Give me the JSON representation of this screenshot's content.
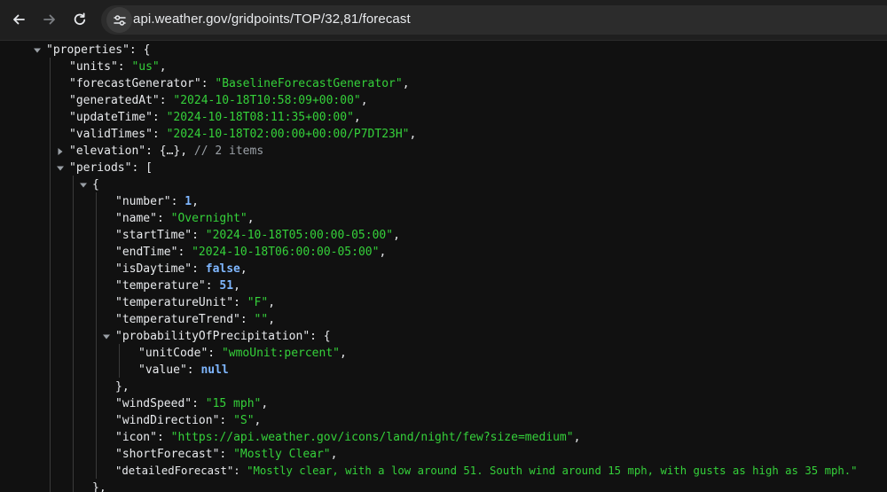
{
  "browser": {
    "url": "api.weather.gov/gridpoints/TOP/32,81/forecast"
  },
  "json": {
    "properties_key": "\"properties\"",
    "units_key": "\"units\"",
    "units_val": "\"us\"",
    "forecastGenerator_key": "\"forecastGenerator\"",
    "forecastGenerator_val": "\"BaselineForecastGenerator\"",
    "generatedAt_key": "\"generatedAt\"",
    "generatedAt_val": "\"2024-10-18T10:58:09+00:00\"",
    "updateTime_key": "\"updateTime\"",
    "updateTime_val": "\"2024-10-18T08:11:35+00:00\"",
    "validTimes_key": "\"validTimes\"",
    "validTimes_val": "\"2024-10-18T02:00:00+00:00/P7DT23H\"",
    "elevation_key": "\"elevation\"",
    "elevation_collapsed": "{…}",
    "elevation_comment": "// 2 items",
    "periods_key": "\"periods\"",
    "number_key": "\"number\"",
    "number_val": "1",
    "name_key": "\"name\"",
    "name_val": "\"Overnight\"",
    "startTime_key": "\"startTime\"",
    "startTime_val": "\"2024-10-18T05:00:00-05:00\"",
    "endTime_key": "\"endTime\"",
    "endTime_val": "\"2024-10-18T06:00:00-05:00\"",
    "isDaytime_key": "\"isDaytime\"",
    "isDaytime_val": "false",
    "temperature_key": "\"temperature\"",
    "temperature_val": "51",
    "temperatureUnit_key": "\"temperatureUnit\"",
    "temperatureUnit_val": "\"F\"",
    "temperatureTrend_key": "\"temperatureTrend\"",
    "temperatureTrend_val": "\"\"",
    "pop_key": "\"probabilityOfPrecipitation\"",
    "unitCode_key": "\"unitCode\"",
    "unitCode_val": "\"wmoUnit:percent\"",
    "value_key": "\"value\"",
    "value_val": "null",
    "windSpeed_key": "\"windSpeed\"",
    "windSpeed_val": "\"15 mph\"",
    "windDirection_key": "\"windDirection\"",
    "windDirection_val": "\"S\"",
    "icon_key": "\"icon\"",
    "icon_val": "\"https://api.weather.gov/icons/land/night/few?size=medium\"",
    "shortForecast_key": "\"shortForecast\"",
    "shortForecast_val": "\"Mostly Clear\"",
    "detailedForecast_key": "\"detailedForecast\"",
    "detailedForecast_val": "\"Mostly clear, with a low around 51. South wind around 15 mph, with gusts as high as 35 mph.\""
  }
}
